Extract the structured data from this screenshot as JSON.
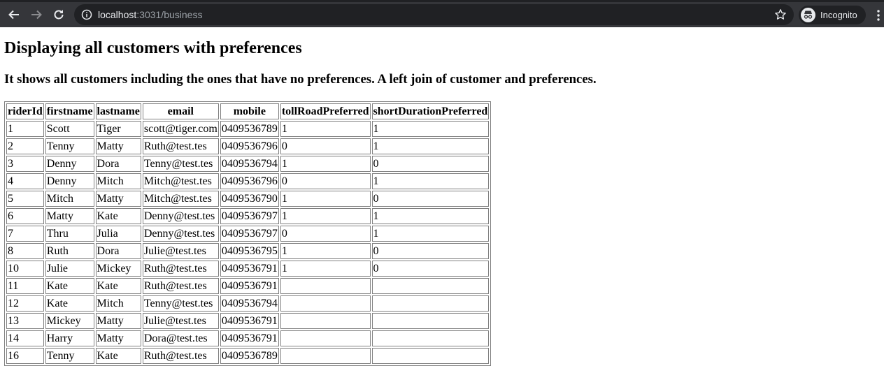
{
  "browser": {
    "url_host": "localhost",
    "url_rest": ":3031/business",
    "incognito_label": "Incognito"
  },
  "page": {
    "title": "Displaying all customers with preferences",
    "subtitle": "It shows all customers including the ones that have no preferences. A left join of customer and preferences."
  },
  "table": {
    "columns": [
      "riderId",
      "firstname",
      "lastname",
      "email",
      "mobile",
      "tollRoadPreferred",
      "shortDurationPreferred"
    ],
    "rows": [
      [
        "1",
        "Scott",
        "Tiger",
        "scott@tiger.com",
        "0409536789",
        "1",
        "1"
      ],
      [
        "2",
        "Tenny",
        "Matty",
        "Ruth@test.tes",
        "0409536796",
        "0",
        "1"
      ],
      [
        "3",
        "Denny",
        "Dora",
        "Tenny@test.tes",
        "0409536794",
        "1",
        "0"
      ],
      [
        "4",
        "Denny",
        "Mitch",
        "Mitch@test.tes",
        "0409536796",
        "0",
        "1"
      ],
      [
        "5",
        "Mitch",
        "Matty",
        "Mitch@test.tes",
        "0409536790",
        "1",
        "0"
      ],
      [
        "6",
        "Matty",
        "Kate",
        "Denny@test.tes",
        "0409536797",
        "1",
        "1"
      ],
      [
        "7",
        "Thru",
        "Julia",
        "Denny@test.tes",
        "0409536797",
        "0",
        "1"
      ],
      [
        "8",
        "Ruth",
        "Dora",
        "Julie@test.tes",
        "0409536795",
        "1",
        "0"
      ],
      [
        "10",
        "Julie",
        "Mickey",
        "Ruth@test.tes",
        "0409536791",
        "1",
        "0"
      ],
      [
        "11",
        "Kate",
        "Kate",
        "Ruth@test.tes",
        "0409536791",
        "",
        ""
      ],
      [
        "12",
        "Kate",
        "Mitch",
        "Tenny@test.tes",
        "0409536794",
        "",
        ""
      ],
      [
        "13",
        "Mickey",
        "Matty",
        "Julie@test.tes",
        "0409536791",
        "",
        ""
      ],
      [
        "14",
        "Harry",
        "Matty",
        "Dora@test.tes",
        "0409536791",
        "",
        ""
      ],
      [
        "16",
        "Tenny",
        "Kate",
        "Ruth@test.tes",
        "0409536789",
        "",
        ""
      ]
    ]
  }
}
